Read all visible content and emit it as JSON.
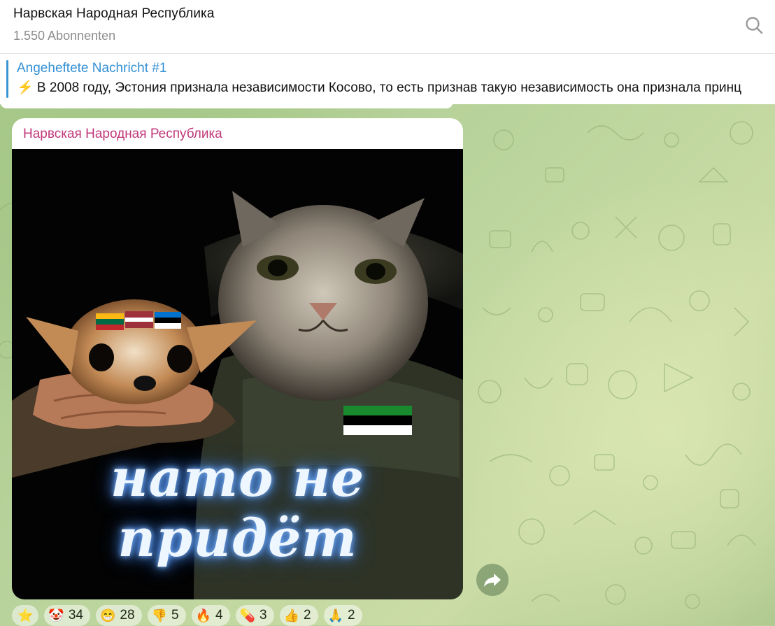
{
  "header": {
    "title": "Нарвская Народная Республика",
    "subscribers": "1.550 Abonnenten",
    "search_icon": "search-icon"
  },
  "pinned": {
    "label": "Angeheftete Nachricht #1",
    "text": "⚡ В 2008 году, Эстония признала независимости Косово, то есть признав такую независимость она признала принц"
  },
  "message": {
    "author": "Нарвская Народная Республика",
    "image_caption": "нато не придёт",
    "forward_icon": "forward-icon"
  },
  "reactions": [
    {
      "emoji": "⭐",
      "count": ""
    },
    {
      "emoji": "🤡",
      "count": "34"
    },
    {
      "emoji": "😁",
      "count": "28"
    },
    {
      "emoji": "👎",
      "count": "5"
    },
    {
      "emoji": "🔥",
      "count": "4"
    },
    {
      "emoji": "💊",
      "count": "3"
    },
    {
      "emoji": "👍",
      "count": "2"
    },
    {
      "emoji": "🙏",
      "count": "2"
    }
  ],
  "colors": {
    "author": "#c1397a",
    "pinned_accent": "#3390d4",
    "estonia_flag": [
      "#0072ce",
      "#000000",
      "#ffffff"
    ],
    "latvia_flag": [
      "#9e3039",
      "#ffffff",
      "#9e3039"
    ],
    "lithuania_flag": [
      "#fdb913",
      "#006a44",
      "#c1272d"
    ]
  }
}
